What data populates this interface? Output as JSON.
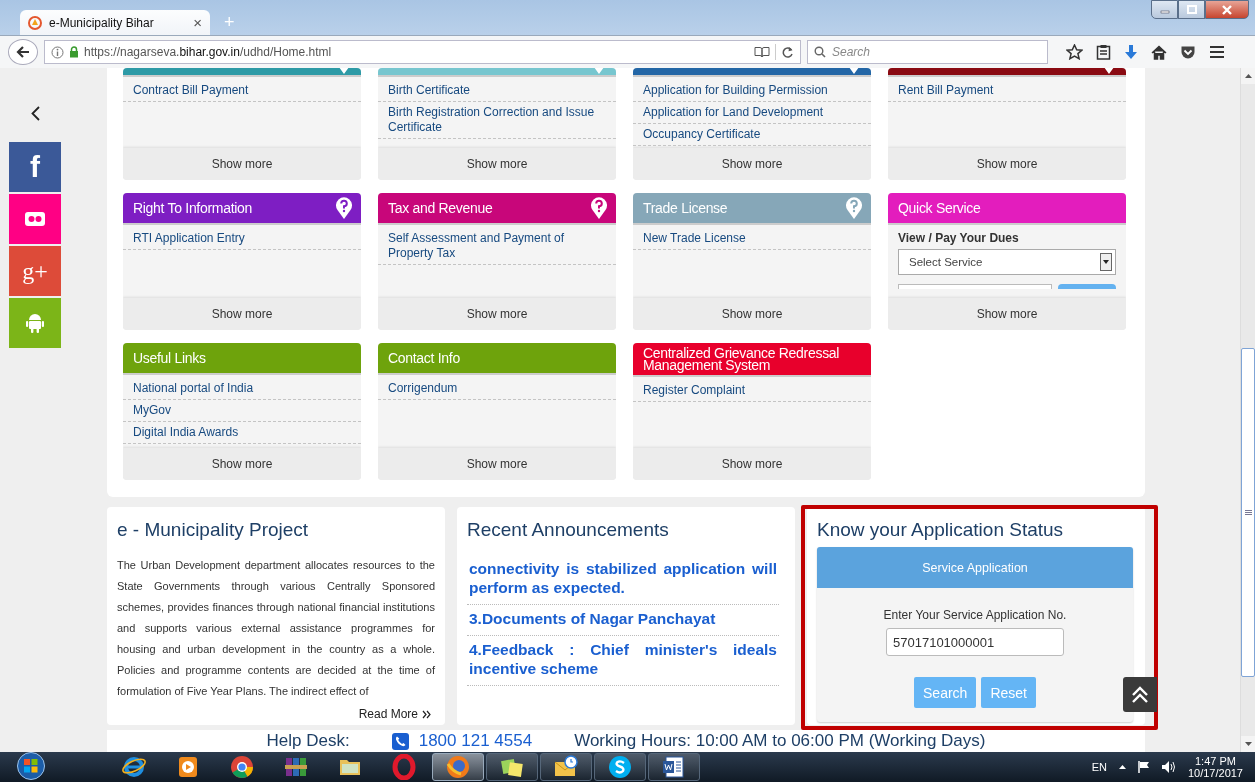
{
  "browser": {
    "tab_title": "e-Municipality Bihar",
    "tab_close": "×",
    "new_tab": "+",
    "url": "https://nagarseva.**bihar.gov.in**/udhd/Home.html",
    "search_placeholder": "Search"
  },
  "social": [
    {
      "kind": "facebook",
      "color": "#3b5998",
      "glyph": "f"
    },
    {
      "kind": "flickr",
      "color": "#ff0084"
    },
    {
      "kind": "googleplus",
      "color": "#dd4b39",
      "glyph": "g+"
    },
    {
      "kind": "android",
      "color": "#7cb518"
    }
  ],
  "cards": [
    {
      "kind": "list",
      "color": "#2d9aa6",
      "help": true,
      "items": [
        "Contract Bill Payment"
      ],
      "footer": "Show more"
    },
    {
      "kind": "list",
      "color": "#77c6cf",
      "help": true,
      "items": [
        "Birth Certificate",
        "Birth Registration Correction and Issue Certificate"
      ],
      "footer": "Show more"
    },
    {
      "kind": "list",
      "color": "#2366a6",
      "help": true,
      "items": [
        "Application for Building Permission",
        "Application for Land Development",
        "Occupancy Certificate"
      ],
      "footer": "Show more"
    },
    {
      "kind": "list",
      "color": "#8a0a12",
      "help": true,
      "items": [
        "Rent Bill Payment"
      ],
      "footer": "Show more"
    },
    {
      "kind": "list",
      "title": "Right To Information",
      "color": "#7e1ec3",
      "help": true,
      "items": [
        "RTI Application Entry"
      ],
      "footer": "Show more"
    },
    {
      "kind": "list",
      "title": "Tax and Revenue",
      "color": "#c8067a",
      "help": true,
      "items": [
        "Self Assessment and Payment of Property Tax"
      ],
      "footer": "Show more"
    },
    {
      "kind": "list",
      "title": "Trade License",
      "color": "#86a7b8",
      "help": true,
      "items": [
        "New Trade License"
      ],
      "footer": "Show more"
    },
    {
      "kind": "quick_service",
      "title": "Quick Service",
      "color": "#e31dbd",
      "help": false,
      "label": "View / Pay Your Dues",
      "select": "Select Service",
      "footer": "Show more"
    },
    {
      "kind": "list",
      "title": "Useful Links",
      "color": "#6ea30c",
      "help": false,
      "items": [
        "National portal of India",
        "MyGov",
        "Digital India Awards"
      ],
      "footer": "Show more"
    },
    {
      "kind": "list",
      "title": "Contact Info",
      "color": "#6ea30c",
      "help": false,
      "items": [
        "Corrigendum"
      ],
      "footer": "Show more"
    },
    {
      "kind": "list",
      "title": "Centralized Grievance Redressal Management System",
      "color": "#e8002c",
      "help": false,
      "items": [
        "Register Complaint"
      ],
      "footer": "Show more"
    }
  ],
  "project": {
    "title": "e - Municipality Project",
    "text": "The Urban Development department allocates resources to the State Governments through various Centrally Sponsored schemes, provides finances through national financial institutions and supports various external assistance programmes for housing and urban development in the country as a whole. Policies and programme contents are decided at the time of formulation of Five Year Plans. The indirect effect of",
    "read_more": "Read More"
  },
  "announcements": {
    "title": "Recent Announcements",
    "items": [
      "connectivity is stabilized application will perform as expected.",
      "3.Documents of Nagar Panchayat",
      "4.Feedback : Chief minister's ideals incentive scheme"
    ]
  },
  "status": {
    "title": "Know your Application Status",
    "box_title": "Service Application",
    "label": "Enter Your Service Application No.",
    "value": "57017101000001",
    "buttons": [
      "Search",
      "Reset"
    ]
  },
  "help_desk": {
    "label": "Help Desk:",
    "phone": "1800 121 4554",
    "hours": "Working Hours: 10:00 AM to 06:00 PM (Working Days)"
  },
  "taskbar": {
    "apps": [
      {
        "kind": "ie",
        "running": false,
        "active": false
      },
      {
        "kind": "media",
        "running": false,
        "active": false
      },
      {
        "kind": "chrome",
        "running": false,
        "active": false
      },
      {
        "kind": "archive",
        "running": false,
        "active": false
      },
      {
        "kind": "folder",
        "running": false,
        "active": false
      },
      {
        "kind": "opera",
        "running": false,
        "active": false
      },
      {
        "kind": "firefox",
        "running": true,
        "active": true
      },
      {
        "kind": "notes",
        "running": true,
        "active": false
      },
      {
        "kind": "outlook",
        "running": true,
        "active": false
      },
      {
        "kind": "skype",
        "running": true,
        "active": false
      },
      {
        "kind": "word",
        "running": true,
        "active": false
      }
    ],
    "language": "EN",
    "time": "1:47 PM",
    "date": "10/17/2017"
  }
}
